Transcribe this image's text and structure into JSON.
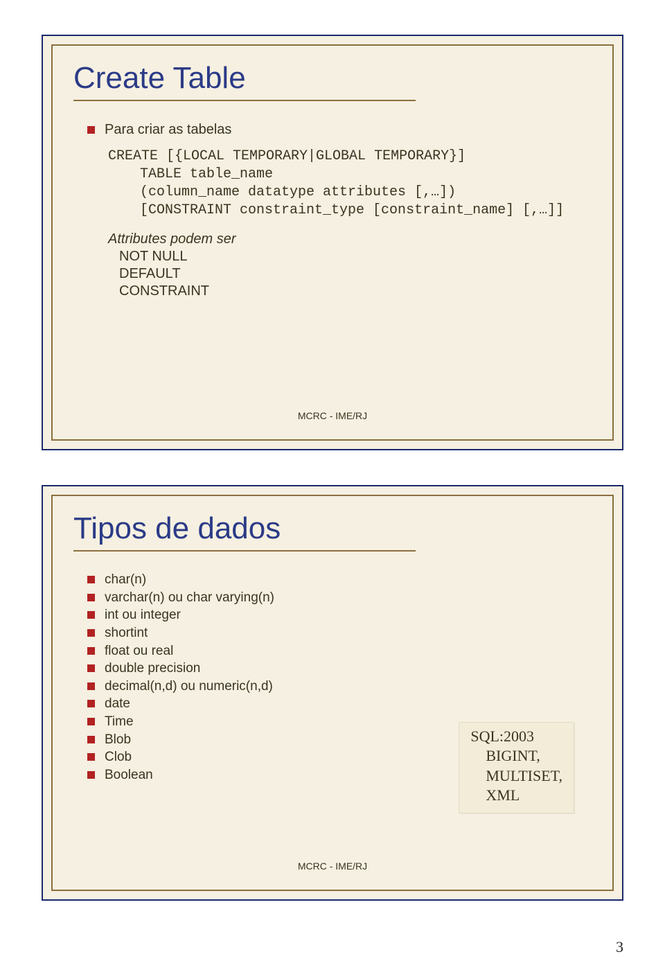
{
  "slide1": {
    "title": "Create Table",
    "bullet": "Para criar as tabelas",
    "code": {
      "l1": "CREATE [{LOCAL TEMPORARY|GLOBAL TEMPORARY}]",
      "l2": "TABLE table_name",
      "l3": "(column_name datatype attributes [,…])",
      "l4": "[CONSTRAINT constraint_type [constraint_name] [,…]]"
    },
    "sub_label": "Attributes podem ser",
    "sub_items": [
      "NOT NULL",
      "DEFAULT",
      "CONSTRAINT"
    ],
    "footer": "MCRC - IME/RJ"
  },
  "slide2": {
    "title": "Tipos de dados",
    "items": [
      "char(n)",
      "varchar(n) ou char varying(n)",
      "int ou integer",
      "shortint",
      "float ou real",
      "double precision",
      "decimal(n,d) ou numeric(n,d)",
      "date",
      "Time",
      "Blob",
      "Clob",
      "Boolean"
    ],
    "sidebox": {
      "head": "SQL:2003",
      "lines": [
        "BIGINT,",
        "MULTISET,",
        "XML"
      ]
    },
    "footer": "MCRC - IME/RJ"
  },
  "page_number": "3"
}
